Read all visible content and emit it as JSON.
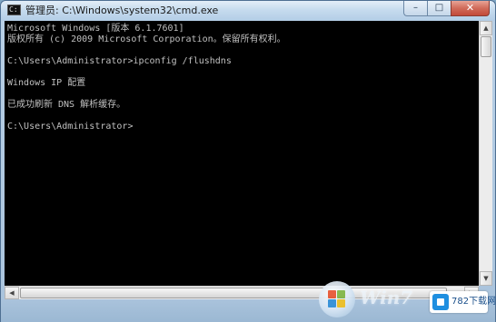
{
  "window": {
    "title": "管理员: C:\\Windows\\system32\\cmd.exe",
    "icon": "cmd-icon",
    "controls": {
      "minimize": "–",
      "maximize": "□",
      "close": "✕"
    }
  },
  "console": {
    "lines": [
      "Microsoft Windows [版本 6.1.7601]",
      "版权所有 (c) 2009 Microsoft Corporation。保留所有权利。",
      "",
      "C:\\Users\\Administrator>ipconfig /flushdns",
      "",
      "Windows IP 配置",
      "",
      "已成功刷新 DNS 解析缓存。",
      "",
      "C:\\Users\\Administrator>"
    ]
  },
  "scrollbars": {
    "up": "▲",
    "down": "▼",
    "left": "◀",
    "right": "▶"
  },
  "watermark": {
    "win7_text": "Win7",
    "site_text": "782下载网",
    "colors": {
      "red": "#e8532f",
      "green": "#7db541",
      "blue": "#2f8fd8",
      "yellow": "#f2c01d"
    }
  }
}
